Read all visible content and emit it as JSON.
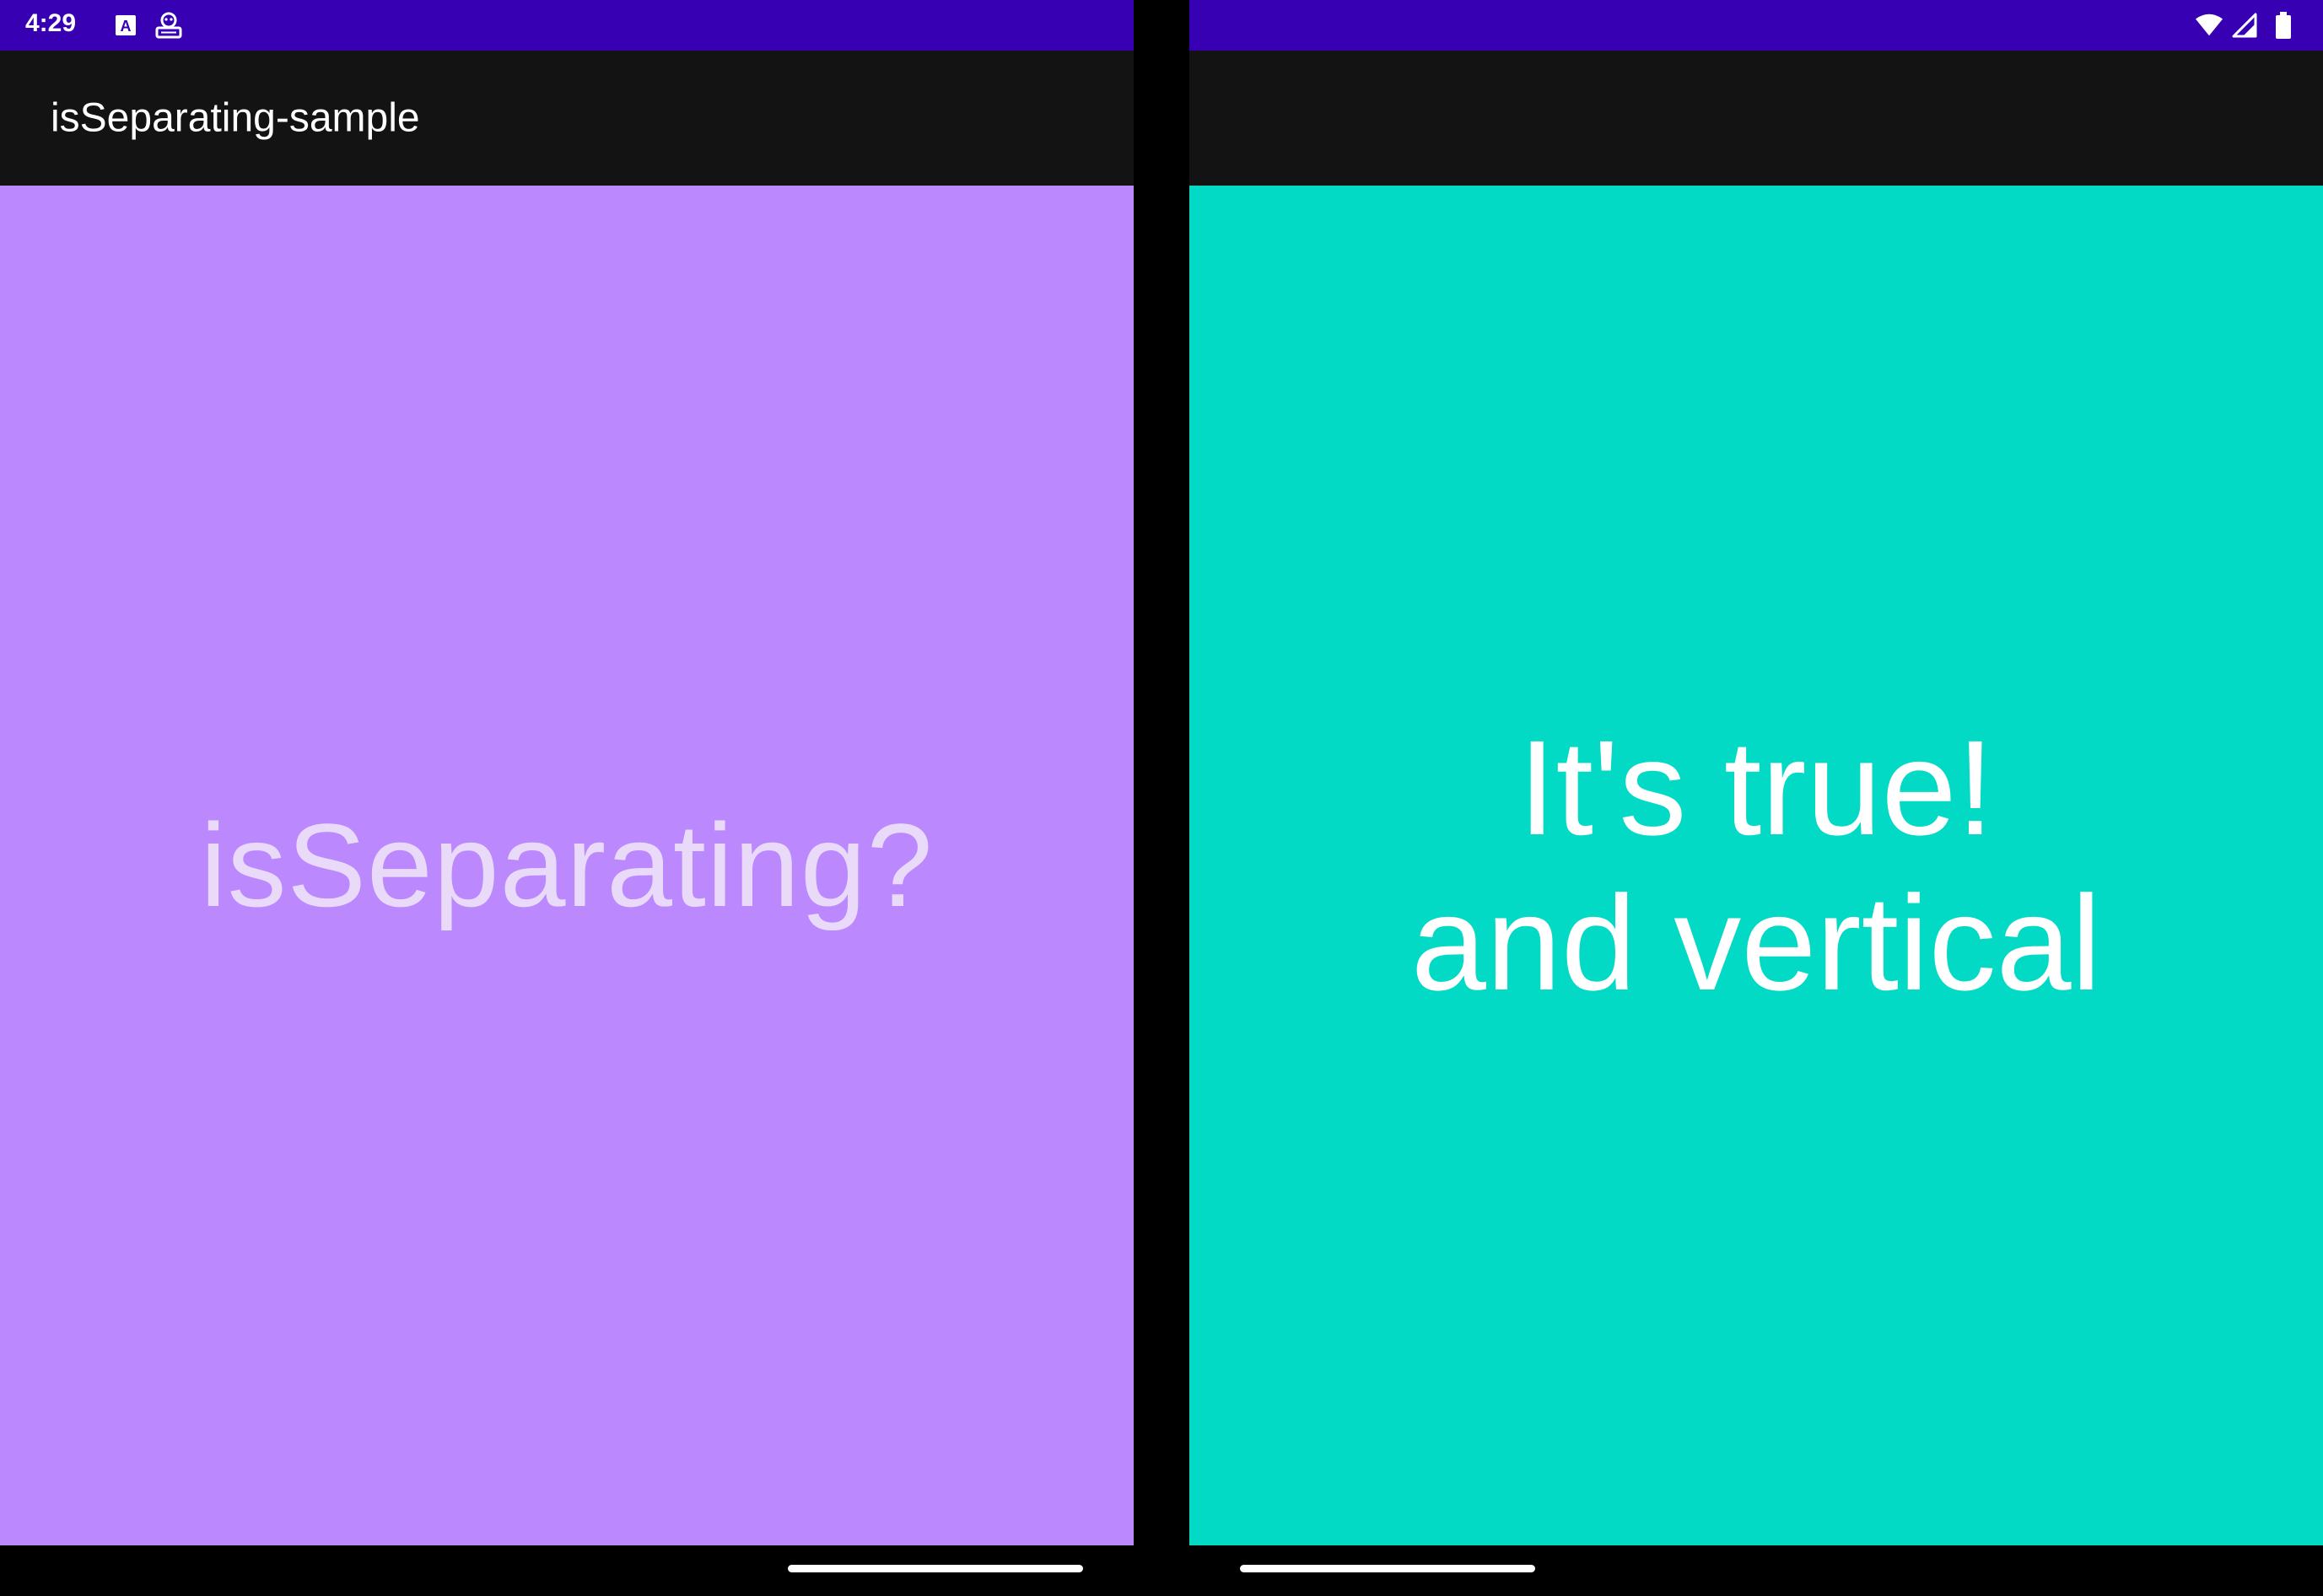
{
  "status_bar": {
    "time": "4:29",
    "background": "#3700b3",
    "left_icons": [
      "text-a-icon",
      "developer-mode-icon"
    ],
    "right_icons": [
      "wifi-icon",
      "cell-signal-icon",
      "battery-icon"
    ]
  },
  "app_bar": {
    "title": "isSeparating-sample",
    "background": "#131313"
  },
  "left_pane": {
    "text": "isSeparating?",
    "background": "#bb88fd",
    "text_color": "#eadaf9"
  },
  "right_pane": {
    "line1": "It's true!",
    "line2": "and vertical",
    "background": "#03dac5",
    "text_color": "#ffffff"
  },
  "navigation": {
    "handle_color": "#ffffff"
  }
}
